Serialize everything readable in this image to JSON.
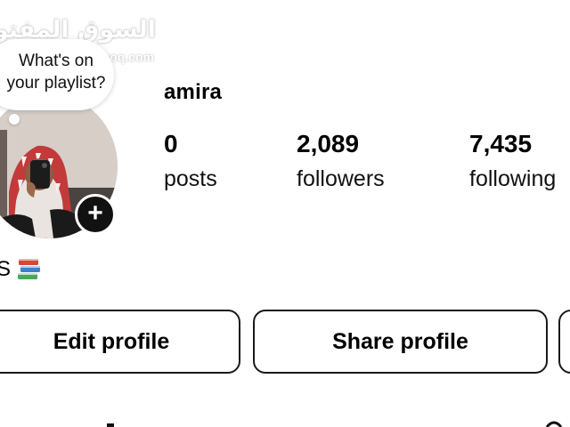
{
  "watermark": {
    "arabic": "السوق المفتوح",
    "latin": "opensooq.com"
  },
  "note": {
    "text": "What's on\nyour playlist?"
  },
  "profile": {
    "username": "amira",
    "add_story_symbol": "+"
  },
  "stats": {
    "posts": {
      "value": "0",
      "label": "posts"
    },
    "followers": {
      "value": "2,089",
      "label": "followers"
    },
    "following": {
      "value": "7,435",
      "label": "following"
    }
  },
  "bio": {
    "text": "S",
    "emoji_icon": "books-icon"
  },
  "actions": {
    "edit_label": "Edit profile",
    "share_label": "Share profile"
  },
  "colors": {
    "text": "#000000",
    "border": "#1a1a1a",
    "background": "#ffffff"
  }
}
